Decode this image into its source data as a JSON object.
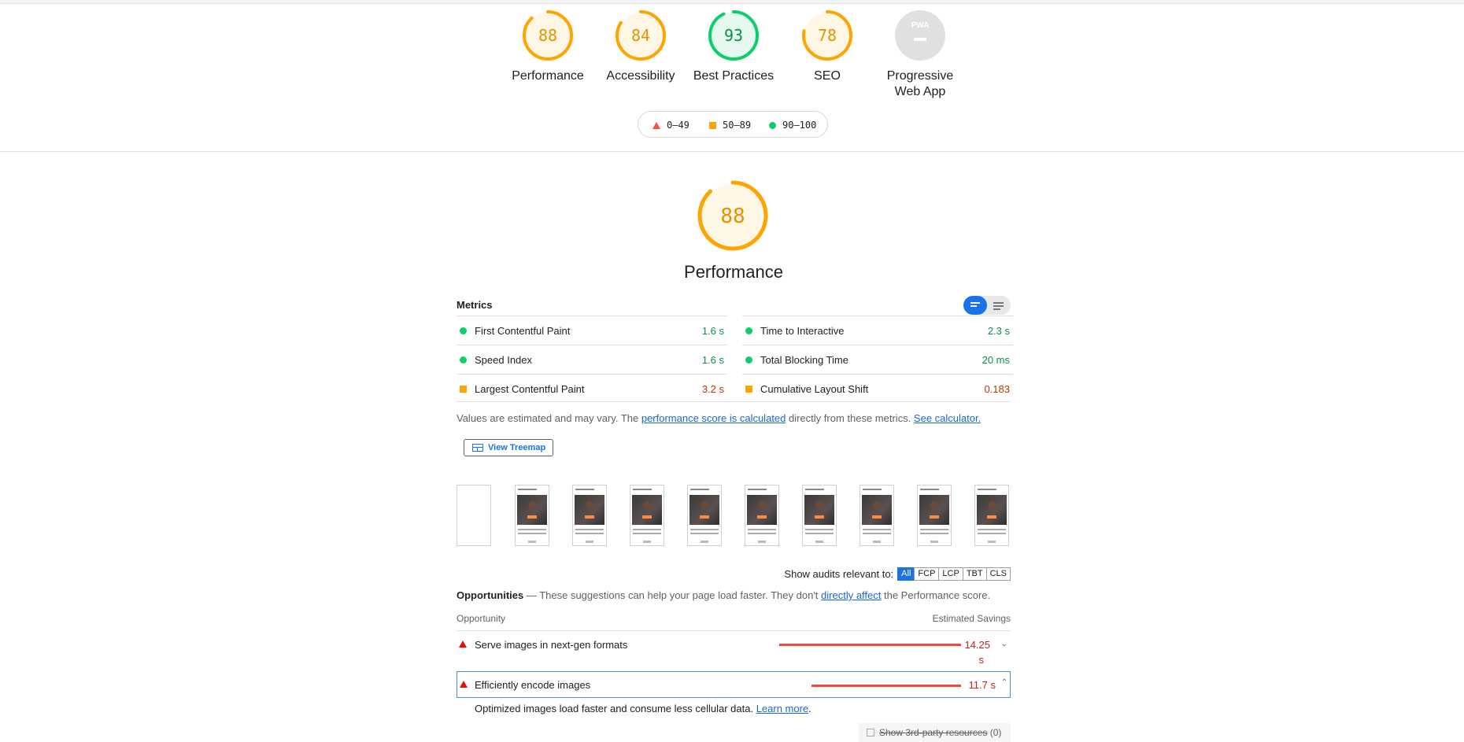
{
  "categories": [
    {
      "label": "Performance",
      "score": "88",
      "color": "#ffa400"
    },
    {
      "label": "Accessibility",
      "score": "84",
      "color": "#ffa400"
    },
    {
      "label": "Best Practices",
      "score": "93",
      "color": "#0cce6b"
    },
    {
      "label": "SEO",
      "score": "78",
      "color": "#ffa400"
    },
    {
      "label": "Progressive\nWeb App",
      "badge": "PWA"
    }
  ],
  "legend": {
    "fail": "0–49",
    "average": "50–89",
    "pass": "90–100"
  },
  "performance": {
    "score": "88",
    "title": "Performance",
    "metrics_title": "Metrics",
    "metrics_left": [
      {
        "name": "First Contentful Paint",
        "value": "1.6 s",
        "status": "pass"
      },
      {
        "name": "Speed Index",
        "value": "1.6 s",
        "status": "pass"
      },
      {
        "name": "Largest Contentful Paint",
        "value": "3.2 s",
        "status": "average"
      }
    ],
    "metrics_right": [
      {
        "name": "Time to Interactive",
        "value": "2.3 s",
        "status": "pass"
      },
      {
        "name": "Total Blocking Time",
        "value": "20 ms",
        "status": "pass"
      },
      {
        "name": "Cumulative Layout Shift",
        "value": "0.183",
        "status": "average"
      }
    ],
    "note_prefix": "Values are estimated and may vary. The ",
    "note_link1": "performance score is calculated",
    "note_mid": " directly from these metrics. ",
    "note_link2": "See calculator.",
    "treemap_label": "View Treemap"
  },
  "filter": {
    "label": "Show audits relevant to:",
    "chips": [
      "All",
      "FCP",
      "LCP",
      "TBT",
      "CLS"
    ]
  },
  "opportunities": {
    "title": "Opportunities",
    "desc_prefix": " — These suggestions can help your page load faster. They don't ",
    "desc_link": "directly affect",
    "desc_suffix": " the Performance score.",
    "col_left": "Opportunity",
    "col_right": "Estimated Savings",
    "items": [
      {
        "title": "Serve images in next-gen formats",
        "savings_num": "14.25",
        "savings_unit": "s",
        "expanded": false
      },
      {
        "title": "Efficiently encode images",
        "savings": "11.7 s",
        "expanded": true
      }
    ],
    "detail_text": "Optimized images load faster and consume less cellular data. ",
    "detail_link": "Learn more",
    "detail_end": ".",
    "thirdparty_label": "Show 3rd-party resources",
    "thirdparty_count": "(0)"
  },
  "colors": {
    "pass": "#0cce6b",
    "average": "#ffa400",
    "fail": "#ff4e42",
    "link": "#1967d2"
  }
}
